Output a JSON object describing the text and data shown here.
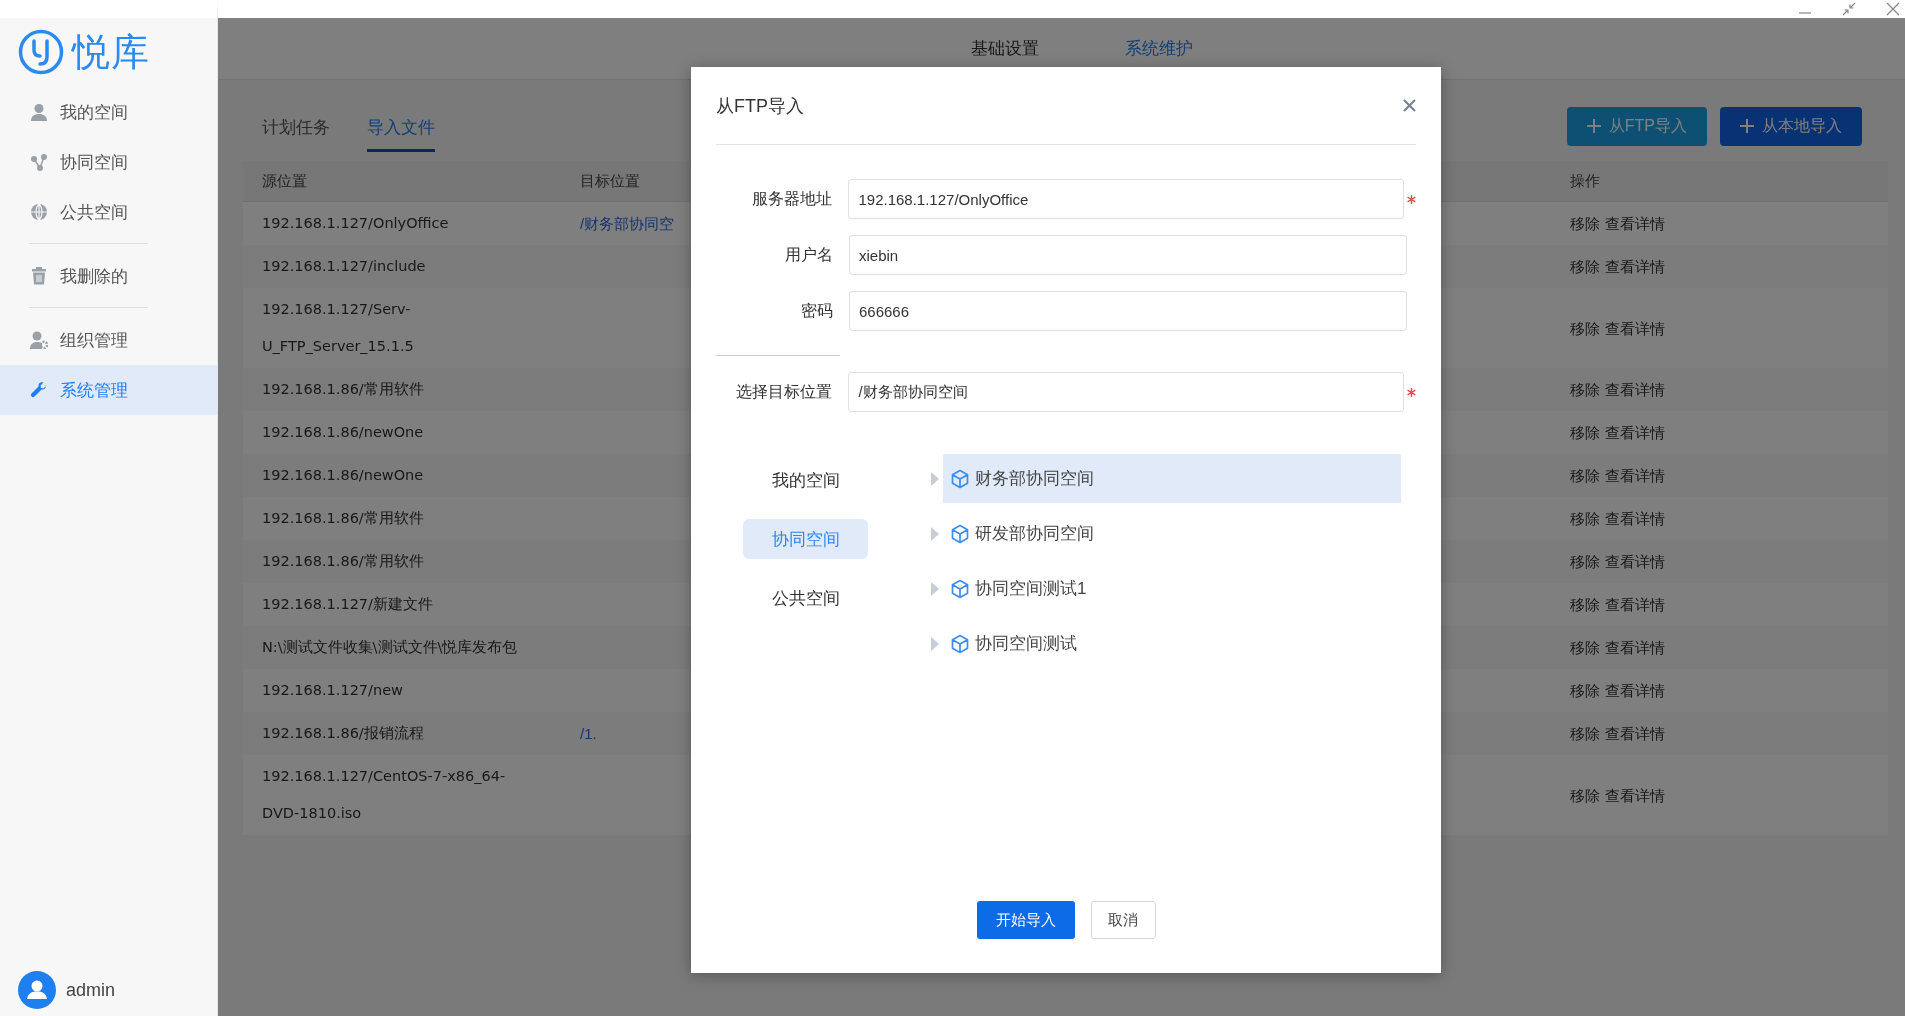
{
  "sidebar": {
    "logo": "悦库",
    "groups": [
      [
        {
          "label": "我的空间",
          "selected": false
        },
        {
          "label": "协同空间",
          "selected": false
        },
        {
          "label": "公共空间",
          "selected": false
        }
      ],
      [
        {
          "label": "我删除的",
          "selected": false
        }
      ],
      [
        {
          "label": "组织管理",
          "selected": false
        },
        {
          "label": "系统管理",
          "selected": true
        }
      ]
    ],
    "user": "admin"
  },
  "header_tabs": [
    {
      "label": "基础设置",
      "selected": false
    },
    {
      "label": "系统维护",
      "selected": true
    }
  ],
  "sub_tabs": [
    {
      "label": "计划任务",
      "selected": false
    },
    {
      "label": "导入文件",
      "selected": true
    }
  ],
  "actions": [
    {
      "label": "从FTP导入",
      "kind": "secondary"
    },
    {
      "label": "从本地导入",
      "kind": "primary"
    }
  ],
  "table": {
    "columns": [
      "源位置",
      "目标位置",
      "操作"
    ],
    "rows": [
      {
        "source": "192.168.1.127/OnlyOffice",
        "target": "/财务部协同空",
        "actions": [
          "移除",
          "查看详情"
        ]
      },
      {
        "source": "192.168.1.127/include",
        "actions": [
          "移除",
          "查看详情"
        ]
      },
      {
        "source": "192.168.1.127/Serv-U_FTP_Server_15.1.5",
        "actions": [
          "移除",
          "查看详情"
        ]
      },
      {
        "source": "192.168.1.86/常用软件",
        "actions": [
          "移除",
          "查看详情"
        ]
      },
      {
        "source": "192.168.1.86/newOne",
        "actions": [
          "移除",
          "查看详情"
        ]
      },
      {
        "source": "192.168.1.86/newOne",
        "actions": [
          "移除",
          "查看详情"
        ]
      },
      {
        "source": "192.168.1.86/常用软件",
        "actions": [
          "移除",
          "查看详情"
        ]
      },
      {
        "source": "192.168.1.86/常用软件",
        "actions": [
          "移除",
          "查看详情"
        ]
      },
      {
        "source": "192.168.1.127/新建文件",
        "actions": [
          "移除",
          "查看详情"
        ]
      },
      {
        "source": "N:\\测试文件收集\\测试文件\\悦库发布包",
        "actions": [
          "移除",
          "查看详情"
        ]
      },
      {
        "source": "192.168.1.127/new",
        "actions": [
          "移除",
          "查看详情"
        ]
      },
      {
        "source": "192.168.1.86/报销流程",
        "target": "/1.",
        "actions": [
          "移除",
          "查看详情"
        ]
      },
      {
        "source": "192.168.1.127/CentOS-7-x86_64-DVD-1810.iso",
        "actions": [
          "移除",
          "查看详情"
        ]
      }
    ]
  },
  "modal": {
    "title": "从FTP导入",
    "fields": [
      {
        "label": "服务器地址",
        "value": "192.168.1.127/OnlyOffice",
        "required": true
      },
      {
        "label": "用户名",
        "value": "xiebin",
        "required": false
      },
      {
        "label": "密码",
        "value": "666666",
        "required": false
      }
    ],
    "target_field": {
      "label": "选择目标位置",
      "value": "/财务部协同空间",
      "required": true
    },
    "spaces": [
      {
        "label": "我的空间",
        "selected": false
      },
      {
        "label": "协同空间",
        "selected": true
      },
      {
        "label": "公共空间",
        "selected": false
      }
    ],
    "tree": [
      {
        "label": "财务部协同空间",
        "selected": true,
        "expanded": false
      },
      {
        "label": "研发部协同空间",
        "selected": false,
        "expanded": false
      },
      {
        "label": "协同空间测试1",
        "selected": false,
        "expanded": false
      },
      {
        "label": "协同空间测试",
        "selected": false,
        "expanded": false
      }
    ],
    "buttons": [
      {
        "label": "开始导入",
        "kind": "primary"
      },
      {
        "label": "取消",
        "kind": "default"
      }
    ]
  }
}
